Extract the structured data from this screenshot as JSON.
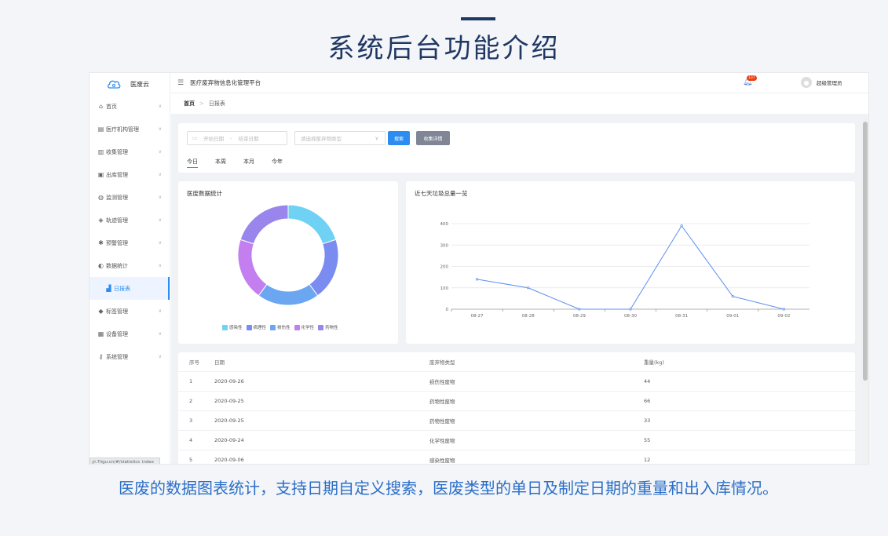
{
  "page": {
    "heading": "系统后台功能介绍",
    "caption": "医废的数据图表统计，支持日期自定义搜索，医废类型的单日及制定日期的重量和出入库情况。"
  },
  "app": {
    "logo_text": "医废云",
    "title": "医疗废弃物信息化管理平台",
    "notification_count": "137",
    "user_name": "超级管理员",
    "status_url": "yl.7ligu.cn/#/statistics_index"
  },
  "sidebar": {
    "items": [
      {
        "label": "首页",
        "icon": "home-icon",
        "glyph": "⌂"
      },
      {
        "label": "医疗机构管理",
        "icon": "hospital-icon",
        "glyph": "▤"
      },
      {
        "label": "收集管理",
        "icon": "collect-icon",
        "glyph": "▥"
      },
      {
        "label": "出库管理",
        "icon": "outbound-icon",
        "glyph": "▣"
      },
      {
        "label": "监测管理",
        "icon": "monitor-icon",
        "glyph": "◍"
      },
      {
        "label": "轨迹管理",
        "icon": "track-icon",
        "glyph": "◈"
      },
      {
        "label": "预警管理",
        "icon": "warning-icon",
        "glyph": "✱"
      },
      {
        "label": "数据统计",
        "icon": "chart-icon",
        "glyph": "◐"
      },
      {
        "label": "日报表",
        "icon": "bar-chart-icon",
        "glyph": "▟"
      },
      {
        "label": "标签管理",
        "icon": "tag-icon",
        "glyph": "◆"
      },
      {
        "label": "设备管理",
        "icon": "device-icon",
        "glyph": "▦"
      },
      {
        "label": "系统管理",
        "icon": "key-icon",
        "glyph": "⚷"
      }
    ]
  },
  "breadcrumb": {
    "home": "首页",
    "current": "日报表"
  },
  "filters": {
    "start_placeholder": "开始日期",
    "dash": "-",
    "end_placeholder": "结束日期",
    "type_placeholder": "请选择废弃物类型",
    "search_label": "搜索",
    "detail_label": "收集详情",
    "tabs": [
      "今日",
      "本周",
      "本月",
      "今年"
    ]
  },
  "donut_title": "医废数据统计",
  "line_title": "近七天垃圾总量一览",
  "chart_data": [
    {
      "type": "pie",
      "title": "医废数据统计",
      "series": [
        {
          "name": "感染性",
          "value": 20,
          "color": "#6fd1f4"
        },
        {
          "name": "病理性",
          "value": 20,
          "color": "#7b8cf0"
        },
        {
          "name": "损伤性",
          "value": 20,
          "color": "#6aa7f0"
        },
        {
          "name": "化学性",
          "value": 20,
          "color": "#c37ff0"
        },
        {
          "name": "药物性",
          "value": 20,
          "color": "#9a85ec"
        }
      ]
    },
    {
      "type": "line",
      "title": "近七天垃圾总量一览",
      "categories": [
        "08-27",
        "08-28",
        "08-29",
        "08-30",
        "08-31",
        "09-01",
        "09-02"
      ],
      "values": [
        140,
        100,
        0,
        0,
        390,
        60,
        0
      ],
      "yticks": [
        0,
        100,
        200,
        300,
        400
      ],
      "ylim": [
        0,
        400
      ],
      "color": "#5b8ff0"
    }
  ],
  "table": {
    "headers": [
      "序号",
      "日期",
      "废弃物类型",
      "重量(kg)"
    ],
    "rows": [
      [
        "1",
        "2020-09-26",
        "损伤性废物",
        "44"
      ],
      [
        "2",
        "2020-09-25",
        "药物性废物",
        "66"
      ],
      [
        "3",
        "2020-09-25",
        "药物性废物",
        "33"
      ],
      [
        "4",
        "2020-09-24",
        "化学性废物",
        "55"
      ],
      [
        "5",
        "2020-09-06",
        "感染性废物",
        "12"
      ]
    ]
  }
}
